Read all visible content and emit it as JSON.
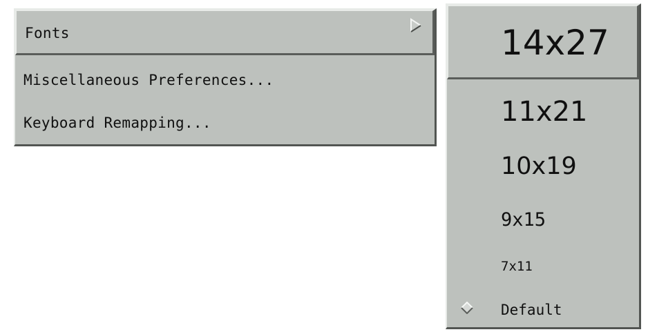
{
  "main_menu": {
    "items": [
      {
        "label": "Fonts",
        "has_submenu": true,
        "active": true
      },
      {
        "label": "Miscellaneous Preferences...",
        "has_submenu": false,
        "active": false
      },
      {
        "label": "Keyboard Remapping...",
        "has_submenu": false,
        "active": false
      }
    ]
  },
  "fonts_submenu": {
    "items": [
      {
        "label": "14x27",
        "active": true
      },
      {
        "label": "11x21",
        "active": false
      },
      {
        "label": "10x19",
        "active": false
      },
      {
        "label": "9x15",
        "active": false
      },
      {
        "label": "7x11",
        "active": false
      },
      {
        "label": "Default",
        "selected": true
      }
    ]
  },
  "colors": {
    "menu_bg": "#bdc1bd",
    "highlight": "#e8ebe8",
    "shadow": "#525552",
    "text": "#101010"
  },
  "icons": {
    "cascade": "right-triangle-arrow-icon",
    "selected_marker": "diamond-icon"
  }
}
